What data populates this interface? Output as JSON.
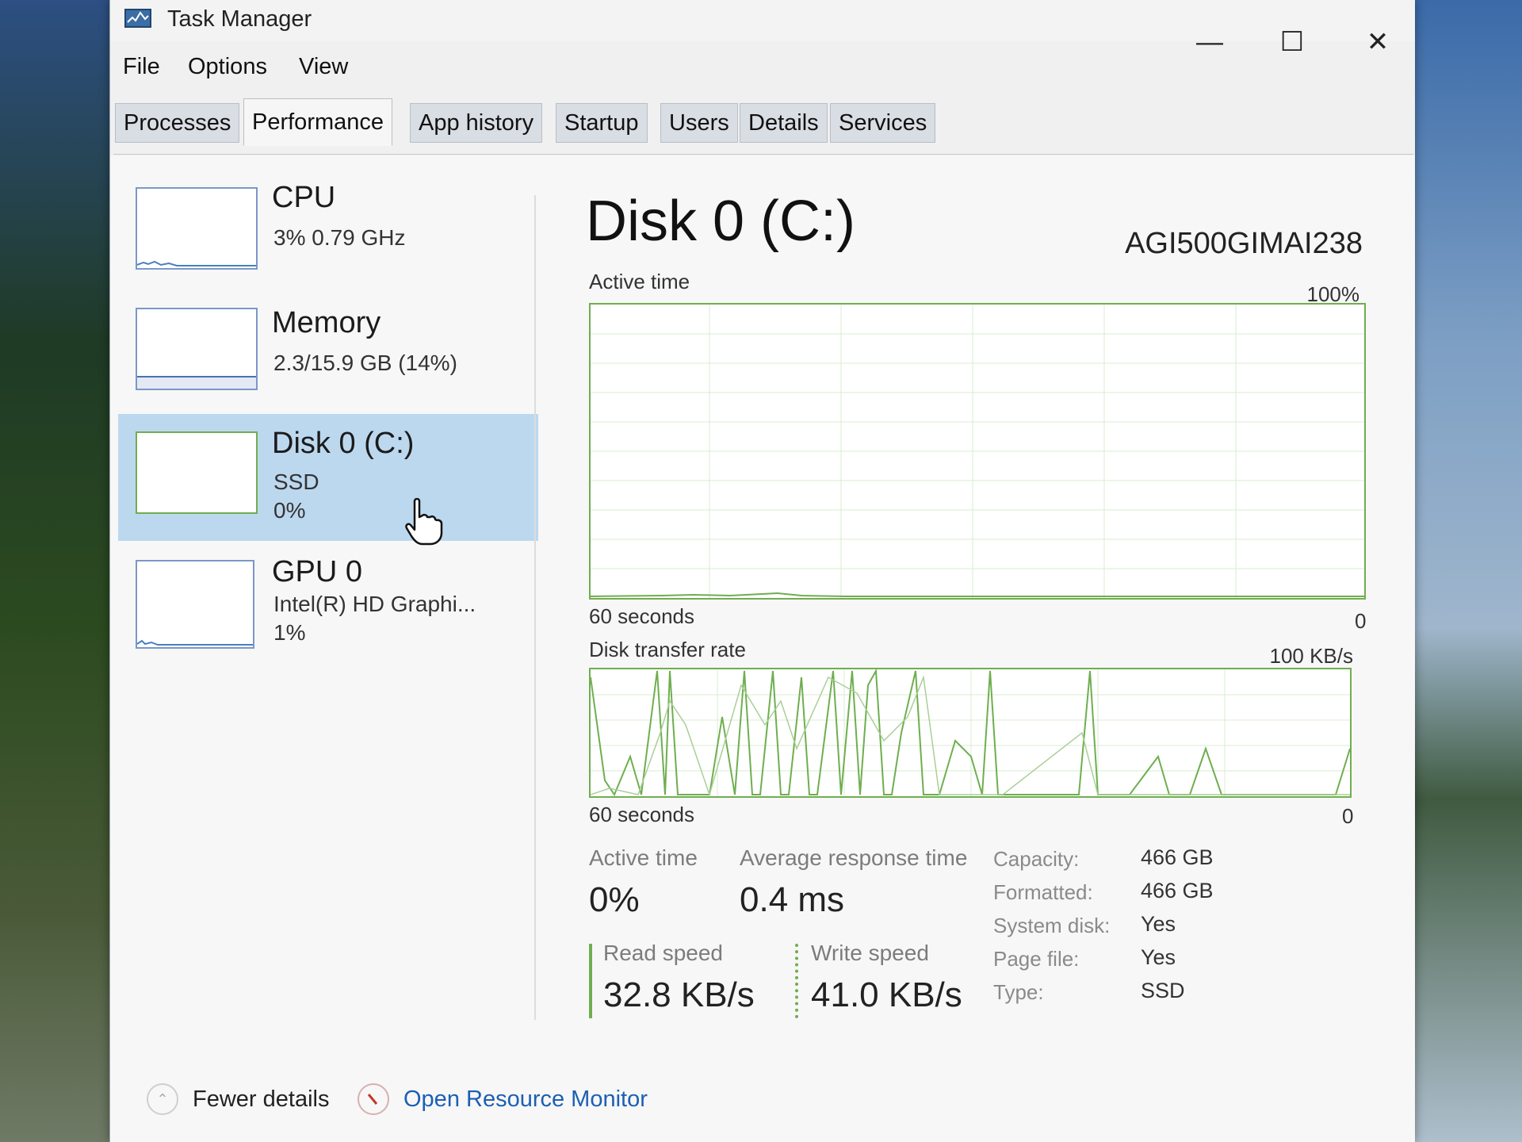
{
  "window": {
    "title": "Task Manager",
    "controls": {
      "minimize": "—",
      "maximize": "☐",
      "close": "✕"
    }
  },
  "menu": [
    "File",
    "Options",
    "View"
  ],
  "tabs": [
    {
      "label": "Processes",
      "active": false
    },
    {
      "label": "Performance",
      "active": true
    },
    {
      "label": "App history",
      "active": false
    },
    {
      "label": "Startup",
      "active": false
    },
    {
      "label": "Users",
      "active": false
    },
    {
      "label": "Details",
      "active": false
    },
    {
      "label": "Services",
      "active": false
    }
  ],
  "sidebar": {
    "items": [
      {
        "name": "CPU",
        "line1": "3%  0.79 GHz",
        "line2": ""
      },
      {
        "name": "Memory",
        "line1": "2.3/15.9 GB (14%)",
        "line2": ""
      },
      {
        "name": "Disk 0 (C:)",
        "line1": "SSD",
        "line2": "0%",
        "selected": true
      },
      {
        "name": "GPU 0",
        "line1": "Intel(R) HD Graphi...",
        "line2": "1%"
      }
    ]
  },
  "main": {
    "title": "Disk 0 (C:)",
    "model": "AGI500GIMAI238",
    "active_graph": {
      "label": "Active time",
      "max": "100%",
      "xlabel": "60 seconds",
      "min": "0"
    },
    "transfer_graph": {
      "label": "Disk transfer rate",
      "max": "100 KB/s",
      "xlabel": "60 seconds",
      "min": "0"
    },
    "stats": {
      "active_time_label": "Active time",
      "active_time_value": "0%",
      "response_label": "Average response time",
      "response_value": "0.4 ms",
      "read_label": "Read speed",
      "read_value": "32.8 KB/s",
      "write_label": "Write speed",
      "write_value": "41.0 KB/s"
    },
    "properties": [
      {
        "label": "Capacity:",
        "value": "466 GB"
      },
      {
        "label": "Formatted:",
        "value": "466 GB"
      },
      {
        "label": "System disk:",
        "value": "Yes"
      },
      {
        "label": "Page file:",
        "value": "Yes"
      },
      {
        "label": "Type:",
        "value": "SSD"
      }
    ]
  },
  "footer": {
    "fewer_details": "Fewer details",
    "open_resource_monitor": "Open Resource Monitor"
  },
  "colors": {
    "graph_border": "#6fae4f",
    "graph_line": "#6fae4f",
    "selection": "#bcd8ef",
    "link": "#1c5fb5"
  }
}
